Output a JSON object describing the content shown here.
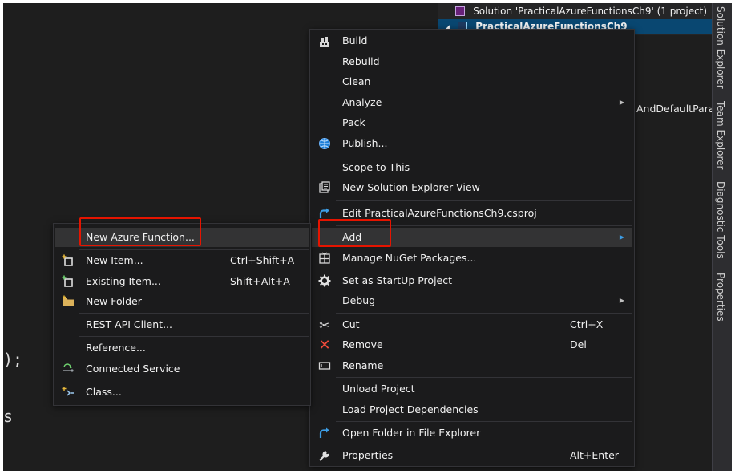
{
  "solution_explorer": {
    "solution_label": "Solution 'PracticalAzureFunctionsCh9' (1 project)",
    "project_label": "PracticalAzureFunctionsCh9",
    "partial_item": "AndDefaultPara"
  },
  "side_tabs": [
    "Solution Explorer",
    "Team Explorer",
    "Diagnostic Tools",
    "Properties"
  ],
  "editor": {
    "frag1": ");",
    "frag2": "s"
  },
  "project_menu": {
    "build": "Build",
    "rebuild": "Rebuild",
    "clean": "Clean",
    "analyze": "Analyze",
    "pack": "Pack",
    "publish": "Publish...",
    "scope": "Scope to This",
    "new_view": "New Solution Explorer View",
    "edit_proj": "Edit PracticalAzureFunctionsCh9.csproj",
    "add": "Add",
    "nuget": "Manage NuGet Packages...",
    "startup": "Set as StartUp Project",
    "debug": "Debug",
    "cut": "Cut",
    "cut_shortcut": "Ctrl+X",
    "remove": "Remove",
    "remove_shortcut": "Del",
    "rename": "Rename",
    "unload": "Unload Project",
    "load_deps": "Load Project Dependencies",
    "open_folder": "Open Folder in File Explorer",
    "properties": "Properties",
    "properties_shortcut": "Alt+Enter"
  },
  "add_menu": {
    "new_azure_function": "New Azure Function...",
    "new_item": "New Item...",
    "new_item_shortcut": "Ctrl+Shift+A",
    "existing_item": "Existing Item...",
    "existing_item_shortcut": "Shift+Alt+A",
    "new_folder": "New Folder",
    "rest_api": "REST API Client...",
    "reference": "Reference...",
    "connected_service": "Connected Service",
    "class": "Class..."
  },
  "colors": {
    "highlight_box": "#e51400",
    "menu_bg": "#1b1b1c",
    "selection": "#094771"
  }
}
